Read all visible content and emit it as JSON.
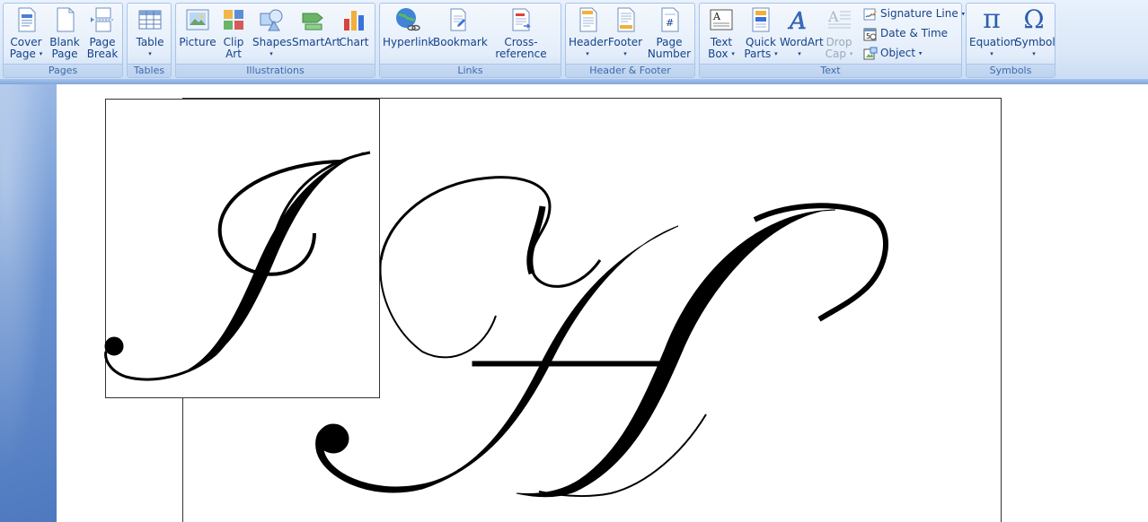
{
  "ribbon": {
    "groups": {
      "pages": "Pages",
      "tables": "Tables",
      "illustrations": "Illustrations",
      "links": "Links",
      "header_footer": "Header & Footer",
      "text": "Text",
      "symbols": "Symbols"
    },
    "buttons": {
      "cover_page_1": "Cover",
      "cover_page_2": "Page",
      "blank_page_1": "Blank",
      "blank_page_2": "Page",
      "page_break_1": "Page",
      "page_break_2": "Break",
      "table": "Table",
      "picture": "Picture",
      "clip_art_1": "Clip",
      "clip_art_2": "Art",
      "shapes": "Shapes",
      "smartart": "SmartArt",
      "chart": "Chart",
      "hyperlink": "Hyperlink",
      "bookmark": "Bookmark",
      "cross_reference": "Cross-reference",
      "header": "Header",
      "footer": "Footer",
      "page_number_1": "Page",
      "page_number_2": "Number",
      "text_box_1": "Text",
      "text_box_2": "Box",
      "quick_parts_1": "Quick",
      "quick_parts_2": "Parts",
      "wordart": "WordArt",
      "drop_cap_1": "Drop",
      "drop_cap_2": "Cap",
      "signature_line": "Signature Line",
      "date_time": "Date & Time",
      "object": "Object",
      "equation": "Equation",
      "symbol": "Symbol"
    },
    "caret": "▾",
    "symbol_glyph": "Ω",
    "pi_glyph": "π"
  },
  "colors": {
    "ribbon_text": "#15428b",
    "group_label_text": "#3e6aaa",
    "gutter_blue": "#5a84c6",
    "ink": "#000000"
  },
  "icons": [
    "cover-page-icon",
    "blank-page-icon",
    "page-break-icon",
    "table-icon",
    "picture-icon",
    "clip-art-icon",
    "shapes-icon",
    "smartart-icon",
    "chart-icon",
    "hyperlink-icon",
    "bookmark-icon",
    "cross-reference-icon",
    "header-icon",
    "footer-icon",
    "page-number-icon",
    "text-box-icon",
    "quick-parts-icon",
    "wordart-icon",
    "drop-cap-icon",
    "signature-line-icon",
    "date-time-icon",
    "object-icon",
    "equation-icon",
    "symbol-icon"
  ]
}
